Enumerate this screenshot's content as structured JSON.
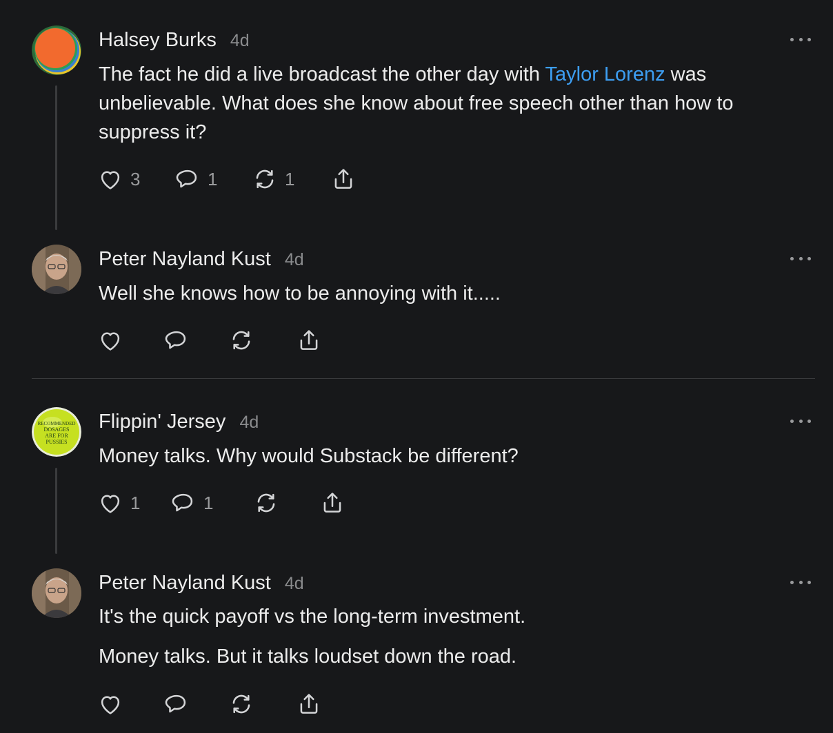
{
  "comments": [
    {
      "author": "Halsey Burks",
      "time": "4d",
      "text_before": "The fact he did a live broadcast the other day with ",
      "mention": "Taylor Lorenz",
      "text_after": " was unbelievable. What does she know about free speech other than how to suppress it?",
      "likes": "3",
      "replies": "1",
      "restacks": "1"
    },
    {
      "author": "Peter Nayland Kust",
      "time": "4d",
      "paragraphs": [
        "Well she knows how to be annoying with it....."
      ]
    },
    {
      "author": "Flippin' Jersey",
      "time": "4d",
      "avatar_text": [
        "RECOMMENDED",
        "DOSAGES",
        "ARE FOR",
        "PUSSIES"
      ],
      "paragraphs": [
        "Money talks. Why would Substack be different?"
      ],
      "likes": "1",
      "replies": "1"
    },
    {
      "author": "Peter Nayland Kust",
      "time": "4d",
      "paragraphs": [
        "It's the quick payoff vs the long-term investment.",
        "Money talks. But it talks loudset down the road."
      ]
    }
  ],
  "icons": {
    "like": "heart-icon",
    "reply": "speech-bubble-icon",
    "restack": "restack-arrows-icon",
    "share": "share-upload-icon",
    "more": "ellipsis-icon"
  },
  "colors": {
    "background": "#17181a",
    "text": "#ececec",
    "muted": "#8a8b8d",
    "link": "#3d9ef2",
    "avatar_lime": "#c6e021"
  }
}
